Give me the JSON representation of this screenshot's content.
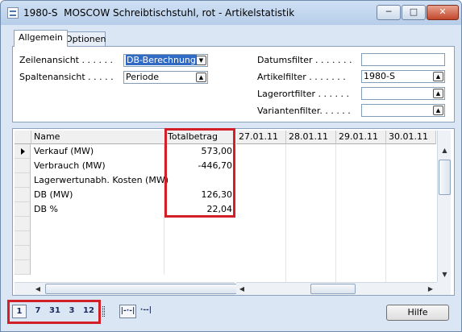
{
  "window": {
    "title": "1980-S  MOSCOW Schreibtischstuhl, rot - Artikelstatistik",
    "minimize_glyph": "─",
    "maximize_glyph": "□",
    "close_glyph": "✕"
  },
  "tabs": [
    {
      "label": "Allgemein",
      "active": true
    },
    {
      "label": "Optionen",
      "active": false
    }
  ],
  "options": {
    "zeilenansicht": {
      "label": "Zeilenansicht . . . . . .",
      "value": "DB-Berechnung",
      "selected": true
    },
    "spaltenansicht": {
      "label": "Spaltenansicht . . . . .",
      "value": "Periode"
    },
    "datumsfilter": {
      "label": "Datumsfilter . . . . . . .",
      "value": ""
    },
    "artikelfilter": {
      "label": "Artikelfilter . . . . . . .",
      "value": "1980-S"
    },
    "lagerortfilter": {
      "label": "Lagerortfilter . . . . . .",
      "value": ""
    },
    "variantenfilter": {
      "label": "Variantenfilter. . . . . .",
      "value": ""
    }
  },
  "grid": {
    "headers": {
      "name": "Name",
      "total": "Totalbetrag"
    },
    "date_columns": [
      "27.01.11",
      "28.01.11",
      "29.01.11",
      "30.01.11"
    ],
    "rows": [
      {
        "name": "Verkauf (MW)",
        "total": "573,00",
        "current": true
      },
      {
        "name": "Verbrauch (MW)",
        "total": "-446,70"
      },
      {
        "name": "Lagerwertunabh. Kosten (MW)",
        "total": ""
      },
      {
        "name": "DB (MW)",
        "total": "126,30"
      },
      {
        "name": "DB %",
        "total": "22,04"
      },
      {
        "name": "",
        "total": ""
      },
      {
        "name": "",
        "total": ""
      },
      {
        "name": "",
        "total": ""
      },
      {
        "name": "",
        "total": ""
      }
    ]
  },
  "period_buttons": [
    "1",
    "7",
    "31",
    "3",
    "12"
  ],
  "amount_buttons": [
    "|-·-|",
    "·--|"
  ],
  "help_button": "Hilfe",
  "colors": {
    "highlight": "#d21f28",
    "selection": "#316ac5"
  }
}
